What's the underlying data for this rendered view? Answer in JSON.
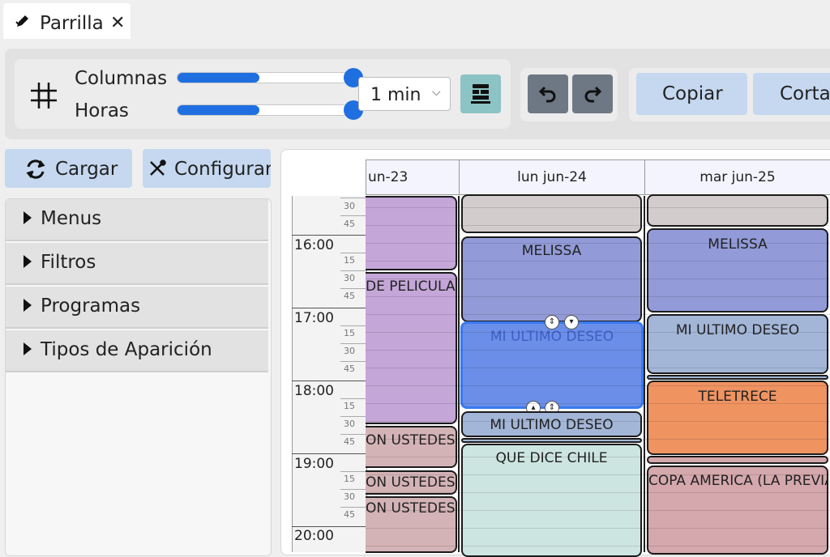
{
  "tab": {
    "label": "Parrilla",
    "close": "✕",
    "icon": "pencil-icon"
  },
  "toolbar": {
    "columns_label": "Columnas",
    "hours_label": "Horas",
    "columns_value": 0.48,
    "hours_value": 0.48,
    "interval": "1 min",
    "copy_label": "Copiar",
    "cut_label": "Corta"
  },
  "left": {
    "load_label": "Cargar",
    "config_label": "Configurar",
    "sections": [
      "Menus",
      "Filtros",
      "Programas",
      "Tipos de Aparición"
    ]
  },
  "grid": {
    "columns": [
      "un-23",
      "lun jun-24",
      "mar jun-25"
    ],
    "hours": [
      "16:00",
      "17:00",
      "18:00",
      "19:00",
      "20:00"
    ],
    "quarters": [
      "15",
      "30",
      "45"
    ],
    "top_quarters": [
      "30",
      "45"
    ],
    "events": {
      "c0_1": "",
      "c0_2": "DE PELICULA",
      "c0_3": "ON USTEDES",
      "c0_4": "ON USTEDES",
      "c0_5": "ON USTEDES",
      "c1_1": "",
      "c1_2": "MELISSA",
      "c1_3": "MI ULTIMO DESEO",
      "c1_4": "MI ULTIMO DESEO",
      "c1_5": "QUE DICE CHILE",
      "c2_1": "",
      "c2_2": "MELISSA",
      "c2_3": "MI ULTIMO DESEO",
      "c2_4": "TELETRECE",
      "c2_5": "",
      "c2_6": "COPA AMERICA (LA PREVIA)"
    },
    "colors": {
      "purple": "#c4a6d8",
      "grey": "#d2cccd",
      "indigo": "#929bd8",
      "selected": "#6b8ee8",
      "steel": "#a3b6d8",
      "mint": "#cde5e0",
      "orange": "#ef9361",
      "rose": "#d4a8ac"
    }
  }
}
